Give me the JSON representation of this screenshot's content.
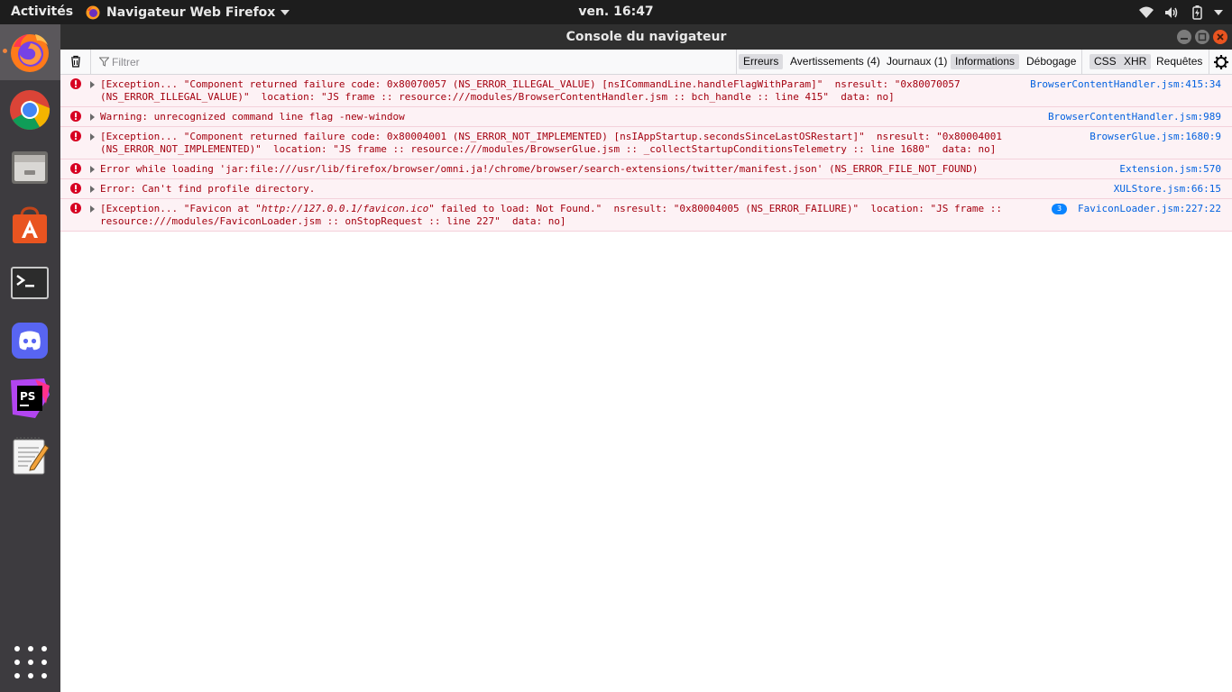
{
  "topbar": {
    "activities": "Activités",
    "app_name": "Navigateur Web Firefox",
    "clock": "ven. 16:47"
  },
  "dock": {
    "items": [
      {
        "name": "firefox",
        "icon": "firefox-icon",
        "active": true
      },
      {
        "name": "chrome",
        "icon": "chrome-icon"
      },
      {
        "name": "files",
        "icon": "files-icon"
      },
      {
        "name": "software",
        "icon": "ubuntu-software-icon"
      },
      {
        "name": "terminal",
        "icon": "terminal-icon"
      },
      {
        "name": "discord",
        "icon": "discord-icon"
      },
      {
        "name": "phpstorm",
        "icon": "phpstorm-icon"
      },
      {
        "name": "text-editor",
        "icon": "text-editor-icon"
      }
    ],
    "show_apps_icon": "grid-icon"
  },
  "window": {
    "title": "Console du navigateur"
  },
  "toolbar": {
    "filter_placeholder": "Filtrer",
    "filters": {
      "errors": "Erreurs",
      "warnings": "Avertissements (4)",
      "logs": "Journaux (1)",
      "info": "Informations",
      "debug": "Débogage",
      "css": "CSS",
      "xhr": "XHR",
      "requests": "Requêtes"
    }
  },
  "messages": [
    {
      "text": "[Exception... \"Component returned failure code: 0x80070057 (NS_ERROR_ILLEGAL_VALUE) [nsICommandLine.handleFlagWithParam]\"  nsresult: \"0x80070057\n(NS_ERROR_ILLEGAL_VALUE)\"  location: \"JS frame :: resource:///modules/BrowserContentHandler.jsm :: bch_handle :: line 415\"  data: no]",
      "location": "BrowserContentHandler.jsm:415:34"
    },
    {
      "text": "Warning: unrecognized command line flag -new-window",
      "location": "BrowserContentHandler.jsm:989"
    },
    {
      "text": "[Exception... \"Component returned failure code: 0x80004001 (NS_ERROR_NOT_IMPLEMENTED) [nsIAppStartup.secondsSinceLastOSRestart]\"  nsresult: \"0x80004001\n(NS_ERROR_NOT_IMPLEMENTED)\"  location: \"JS frame :: resource:///modules/BrowserGlue.jsm :: _collectStartupConditionsTelemetry :: line 1680\"  data: no]",
      "location": "BrowserGlue.jsm:1680:9"
    },
    {
      "text": "Error while loading 'jar:file:///usr/lib/firefox/browser/omni.ja!/chrome/browser/search-extensions/twitter/manifest.json' (NS_ERROR_FILE_NOT_FOUND)",
      "location": "Extension.jsm:570"
    },
    {
      "text": "Error: Can't find profile directory.",
      "location": "XULStore.jsm:66:15"
    },
    {
      "text_before": "[Exception... \"Favicon at \"",
      "text_url": "http://127.0.0.1/favicon.ico",
      "text_after": "\" failed to load: Not Found.\"  nsresult: \"0x80004005 (NS_ERROR_FAILURE)\"  location: \"JS frame ::\nresource:///modules/FaviconLoader.jsm :: onStopRequest :: line 227\"  data: no]",
      "repeat_count": "3",
      "location": "FaviconLoader.jsm:227:22"
    }
  ],
  "colors": {
    "error_text": "#a4000f",
    "error_bg": "#fdf2f5",
    "link": "#0060df",
    "dock_bg": "#3d3b3f",
    "topbar_bg": "#1d1d1d",
    "ubuntu_orange": "#e95420"
  }
}
